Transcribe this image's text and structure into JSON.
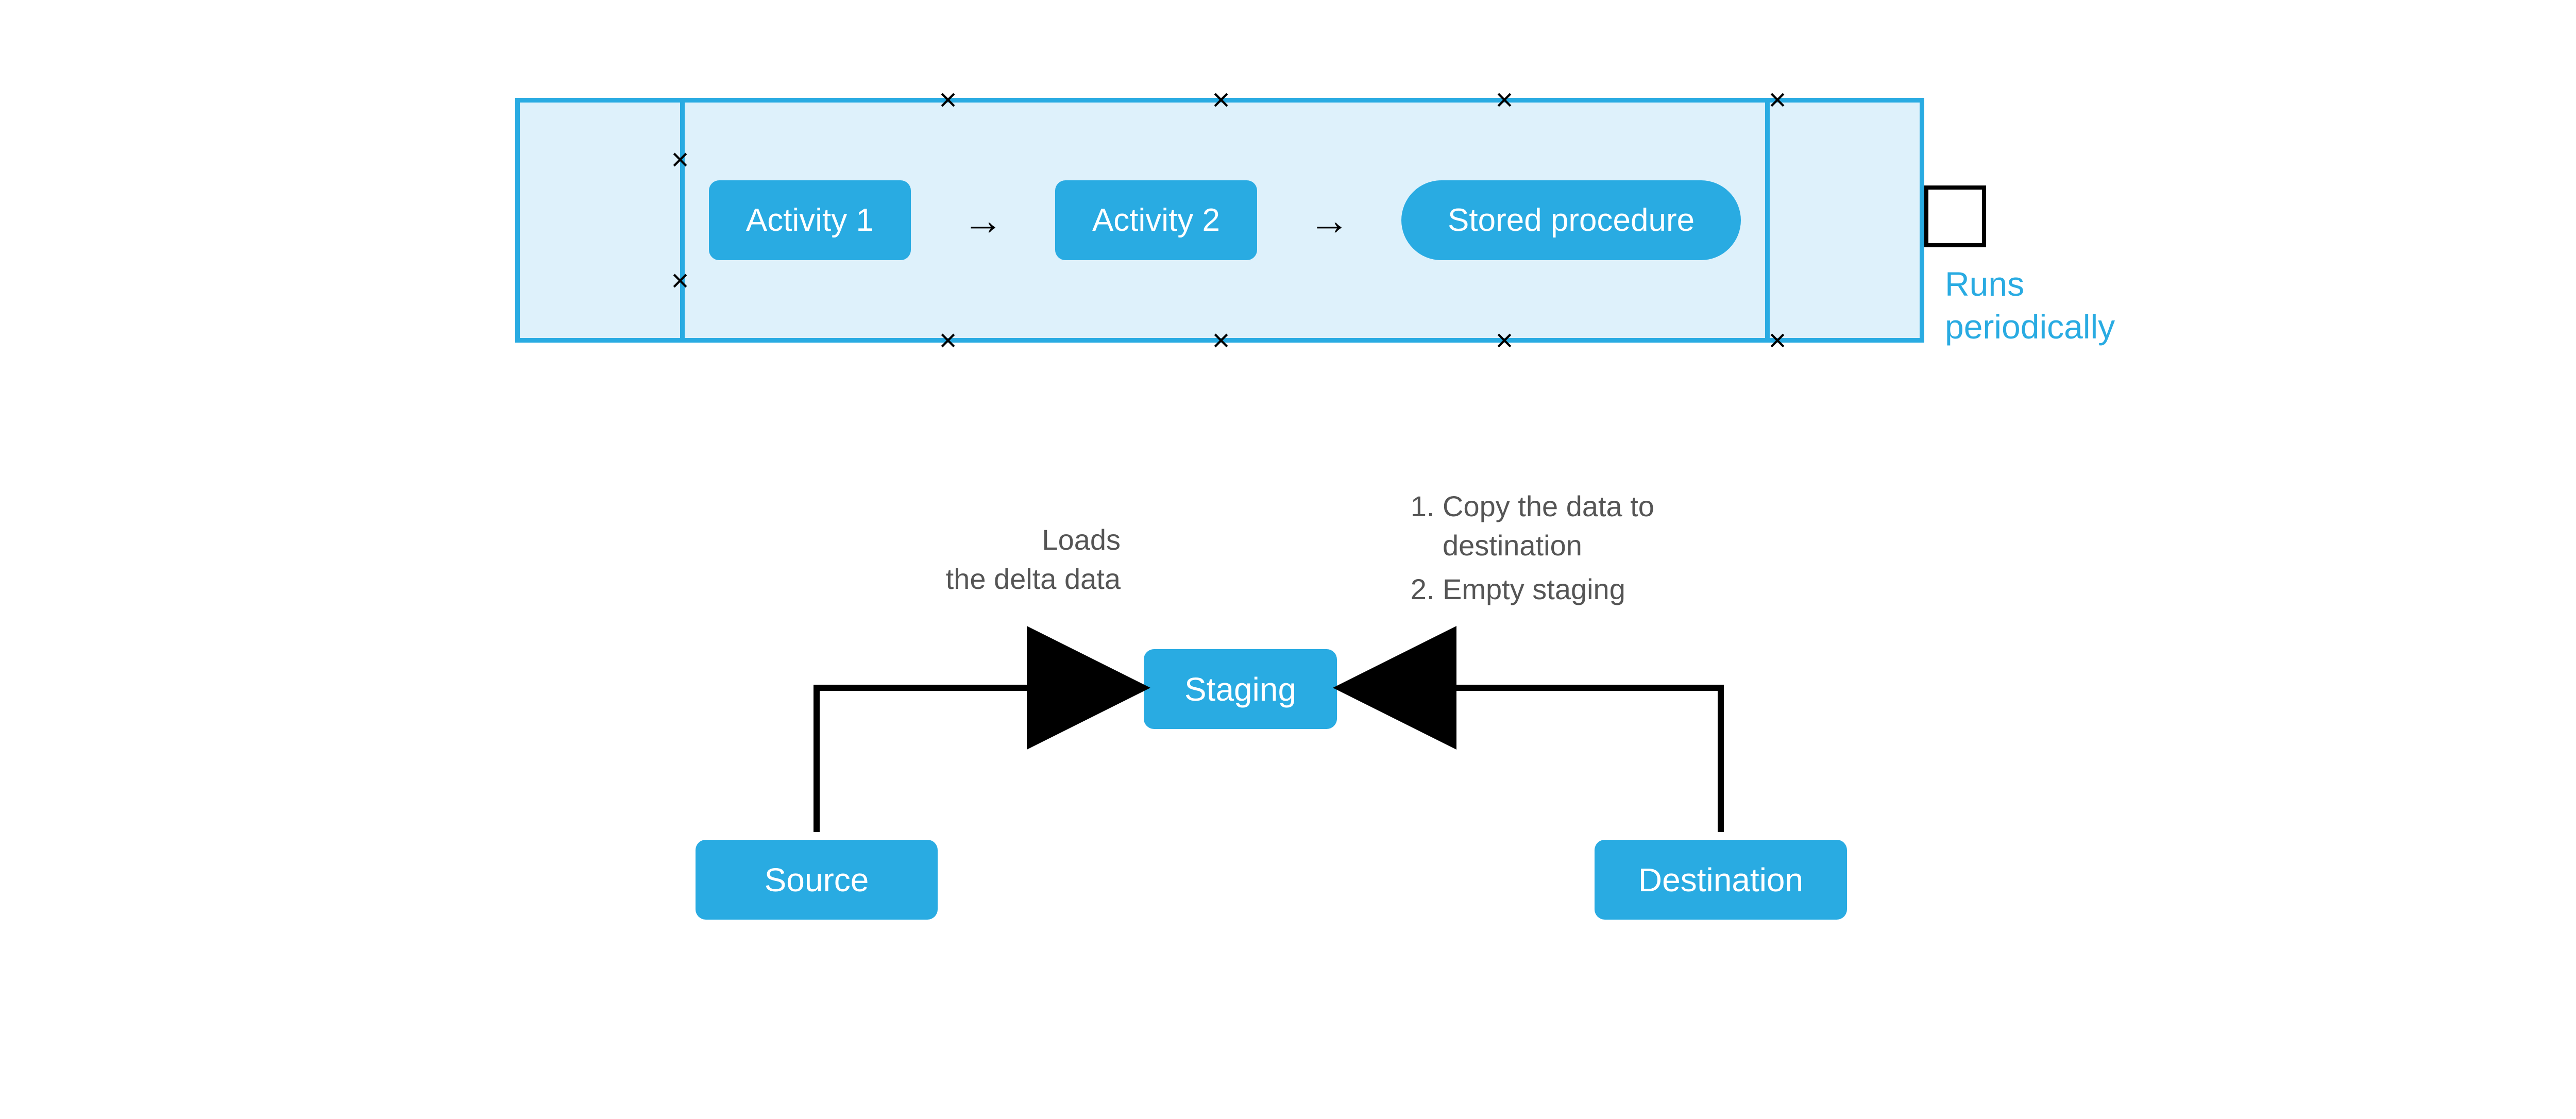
{
  "pipeline": {
    "activities": [
      "Activity 1",
      "Activity 2"
    ],
    "stored_procedure": "Stored procedure",
    "runs_label": "Runs periodically"
  },
  "flow": {
    "source": "Source",
    "staging": "Staging",
    "destination": "Destination",
    "left_text": {
      "line1": "Loads",
      "line2": "the delta data"
    },
    "right_text": {
      "item1": "Copy the data to destination",
      "item2": "Empty staging"
    }
  }
}
